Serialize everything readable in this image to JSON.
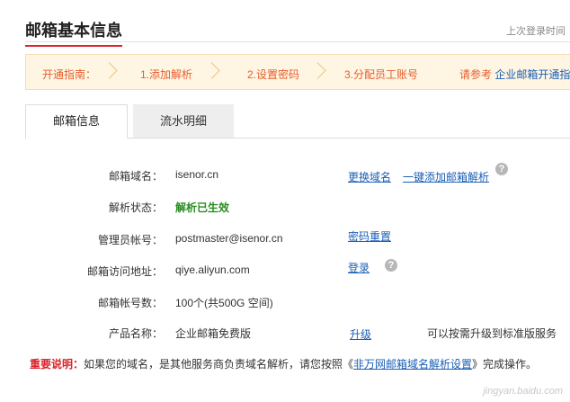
{
  "header": {
    "title": "邮箱基本信息",
    "last_login": "上次登录时间"
  },
  "guide": {
    "label": "开通指南：",
    "steps": [
      "1.添加解析",
      "2.设置密码",
      "3.分配员工账号"
    ],
    "ref_prefix": "请参考",
    "ref_link": "企业邮箱开通指"
  },
  "tabs": [
    {
      "label": "邮箱信息",
      "active": true
    },
    {
      "label": "流水明细",
      "active": false
    }
  ],
  "info": {
    "domain": {
      "label": "邮箱域名：",
      "value": "isenor.cn",
      "change_link": "更换域名",
      "add_link": "一键添加邮箱解析"
    },
    "status": {
      "label": "解析状态：",
      "value": "解析已生效"
    },
    "admin": {
      "label": "管理员帐号：",
      "value": "postmaster@isenor.cn",
      "reset_link": "密码重置"
    },
    "access": {
      "label": "邮箱访问地址：",
      "value": "qiye.aliyun.com",
      "login_link": "登录"
    },
    "accounts": {
      "label": "邮箱帐号数：",
      "value": "100个(共500G 空间)"
    },
    "product": {
      "label": "产品名称：",
      "value": "企业邮箱免费版",
      "upgrade_link": "升级",
      "upgrade_note": "可以按需升级到标准版服务"
    }
  },
  "notice": {
    "important": "重要说明：",
    "text": "如果您的域名，是其他服务商负责域名解析，请您按照《",
    "link": "非万网邮箱域名解析设置",
    "suffix": "》完成操作。"
  },
  "watermark": "jingyan.baidu.com",
  "colors": {
    "accent": "#d9242a",
    "guide_text": "#e85d2c",
    "link": "#1a5fb4",
    "success": "#2a8c21"
  }
}
